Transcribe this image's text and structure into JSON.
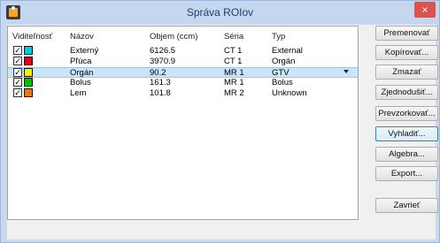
{
  "window": {
    "title": "Správa ROIov",
    "close_label": "×",
    "colors": {
      "titlebar": "#c5d7ee",
      "close": "#d9534f",
      "selection": "#cce4f7"
    }
  },
  "table": {
    "headers": {
      "visibility": "Viditeľnosť",
      "name": "Názov",
      "volume": "Objem (ccm)",
      "series": "Séria",
      "type": "Typ"
    },
    "rows": [
      {
        "checked": true,
        "check": "✓",
        "color": "#00c8e6",
        "name": "Externý",
        "volume": "6126.5",
        "series": "CT 1",
        "type": "External"
      },
      {
        "checked": true,
        "check": "✓",
        "color": "#e60012",
        "name": "Pľúca",
        "volume": "3970.9",
        "series": "CT 1",
        "type": "Orgán"
      },
      {
        "checked": true,
        "check": "✓",
        "color": "#ffee00",
        "name": "Orgán",
        "volume": "90.2",
        "series": "MR 1",
        "type": "GTV"
      },
      {
        "checked": true,
        "check": "✓",
        "color": "#00c000",
        "name": "Bolus",
        "volume": "161.3",
        "series": "MR 1",
        "type": "Bolus"
      },
      {
        "checked": true,
        "check": "✓",
        "color": "#f07800",
        "name": "Lem",
        "volume": "101.8",
        "series": "MR 2",
        "type": "Unknown"
      }
    ],
    "selected_index": 2
  },
  "buttons": {
    "rename": "Premenovať",
    "copy": "Kopírovať...",
    "delete": "Zmazať",
    "simplify": "Zjednodušiť...",
    "resample": "Prevzorkovať...",
    "smooth": "Vyhladiť...",
    "algebra": "Algebra...",
    "export": "Export...",
    "close": "Zavrieť"
  }
}
